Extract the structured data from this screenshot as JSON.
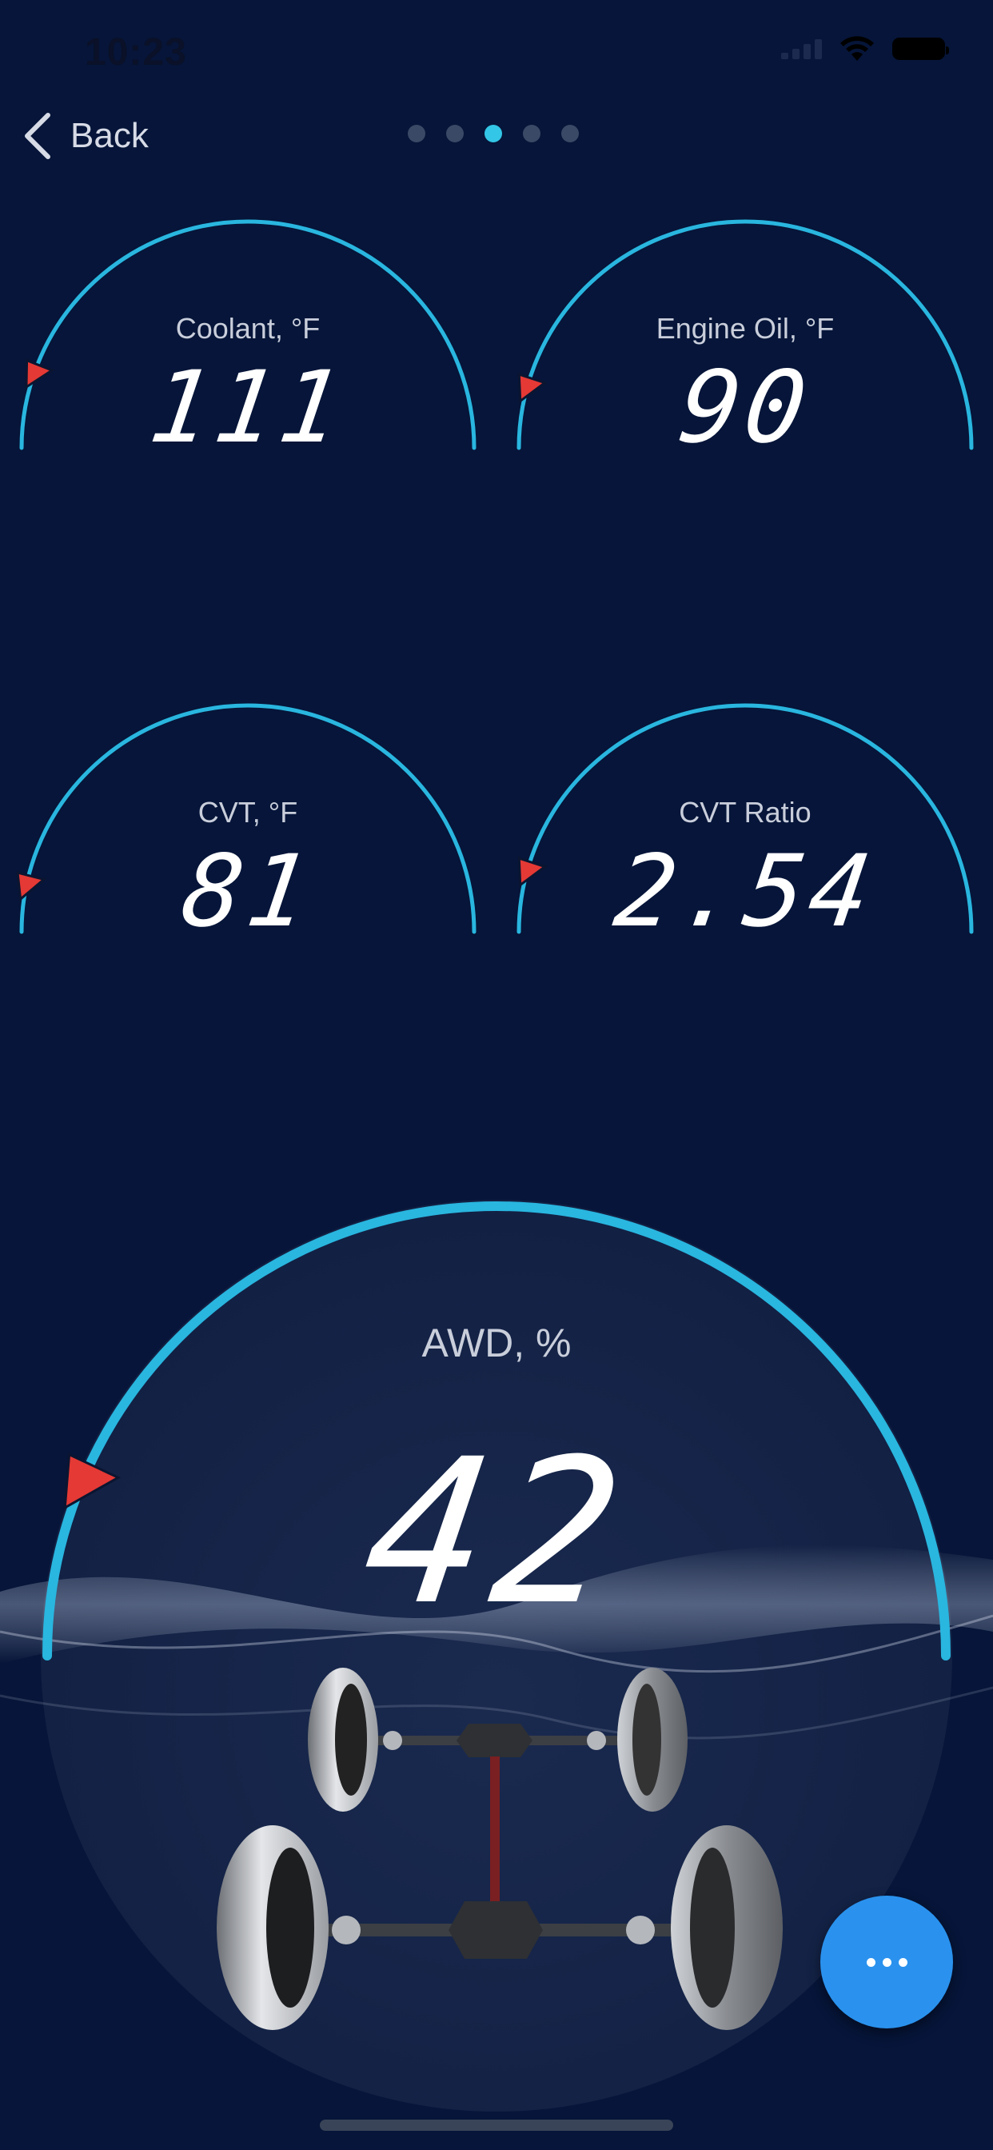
{
  "status_bar": {
    "time": "10:23",
    "icons": [
      "signal-icon",
      "wifi-icon",
      "battery-icon"
    ]
  },
  "nav": {
    "back_label": "Back",
    "pages_total": 5,
    "active_page_index": 2
  },
  "gauges": [
    {
      "label": "Coolant, °F",
      "value": "111",
      "needle_fraction": 0.12
    },
    {
      "label": "Engine Oil, °F",
      "value": "90",
      "needle_fraction": 0.1
    },
    {
      "label": "CVT, °F",
      "value": "81",
      "needle_fraction": 0.08
    },
    {
      "label": "CVT Ratio",
      "value": "2.54",
      "needle_fraction": 0.1
    }
  ],
  "awd_gauge": {
    "label": "AWD, %",
    "value": "42",
    "needle_fraction": 0.14
  },
  "colors": {
    "background": "#061539",
    "arc": "#29b6df",
    "needle": "#e53935",
    "fab": "#2a92ee"
  },
  "fab": {
    "icon": "more-icon"
  }
}
